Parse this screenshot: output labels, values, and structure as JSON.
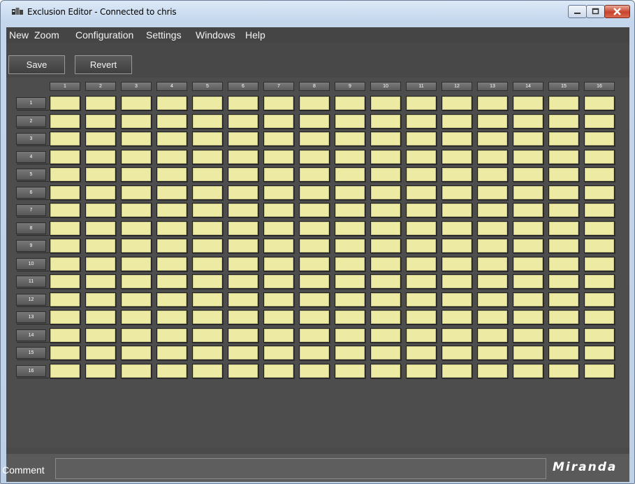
{
  "window": {
    "title": "Exclusion Editor - Connected to chris"
  },
  "menu": [
    "New",
    "Zoom",
    "Configuration",
    "Settings",
    "Windows",
    "Help"
  ],
  "toolbar": {
    "save_label": "Save",
    "revert_label": "Revert"
  },
  "matrix": {
    "columns": [
      "1",
      "2",
      "3",
      "4",
      "5",
      "6",
      "7",
      "8",
      "9",
      "10",
      "11",
      "12",
      "13",
      "14",
      "15",
      "16"
    ],
    "rows": [
      "1",
      "2",
      "3",
      "4",
      "5",
      "6",
      "7",
      "8",
      "9",
      "10",
      "11",
      "12",
      "13",
      "14",
      "15",
      "16"
    ]
  },
  "comment": {
    "label": "Comment",
    "value": ""
  },
  "brand": {
    "logo_text": "Miranda"
  },
  "colors": {
    "cell_fill": "#edeaa4",
    "background": "#4a4a4a",
    "header_fill": "#6a6a6a"
  },
  "icons": {
    "app": "app-icon",
    "minimize": "minimize-icon",
    "maximize": "maximize-icon",
    "close": "close-icon"
  }
}
